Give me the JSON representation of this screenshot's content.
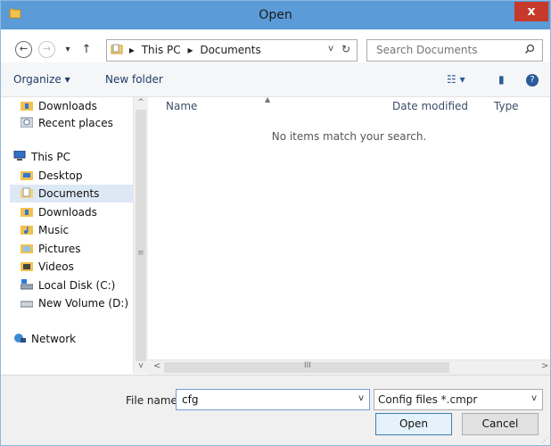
{
  "window": {
    "title": "Open",
    "close_label": "x",
    "accent": "#5a9bd8"
  },
  "nav": {
    "back_glyph": "←",
    "forward_glyph": "→",
    "recent_glyph": "▾",
    "up_glyph": "↑"
  },
  "address": {
    "separator": "▸",
    "crumbs": [
      "This PC",
      "Documents"
    ],
    "dropdown_glyph": "v",
    "refresh_glyph": "↻"
  },
  "search": {
    "placeholder": "Search Documents",
    "icon": "search-icon"
  },
  "toolbar": {
    "organize": "Organize ▾",
    "new_folder": "New folder",
    "view_glyph": "☷ ▾",
    "pane_glyph": "▮",
    "help_glyph": "?"
  },
  "sidebar": {
    "items": [
      {
        "label": "Downloads",
        "icon": "downloads-folder-icon"
      },
      {
        "label": "Recent places",
        "icon": "recent-places-icon"
      },
      {
        "label": "This PC",
        "icon": "computer-icon"
      },
      {
        "label": "Desktop",
        "icon": "desktop-folder-icon"
      },
      {
        "label": "Documents",
        "icon": "documents-folder-icon",
        "selected": true
      },
      {
        "label": "Downloads",
        "icon": "downloads-folder-icon"
      },
      {
        "label": "Music",
        "icon": "music-folder-icon"
      },
      {
        "label": "Pictures",
        "icon": "pictures-folder-icon"
      },
      {
        "label": "Videos",
        "icon": "videos-folder-icon"
      },
      {
        "label": "Local Disk (C:)",
        "icon": "local-disk-icon"
      },
      {
        "label": "New Volume (D:)",
        "icon": "drive-icon"
      },
      {
        "label": "Network",
        "icon": "network-icon"
      }
    ]
  },
  "content": {
    "columns": [
      "Name",
      "Date modified",
      "Type"
    ],
    "empty_message": "No items match your search."
  },
  "scroll": {
    "up": "^",
    "down": "v",
    "left": "<",
    "right": ">",
    "grip_v": "≡",
    "grip_h": "III"
  },
  "footer": {
    "file_name_label": "File name:",
    "file_name_value": "cfg",
    "file_type_value": "Config files *.cmpr",
    "dropdown_glyph": "v",
    "open_label": "Open",
    "cancel_label": "Cancel"
  }
}
